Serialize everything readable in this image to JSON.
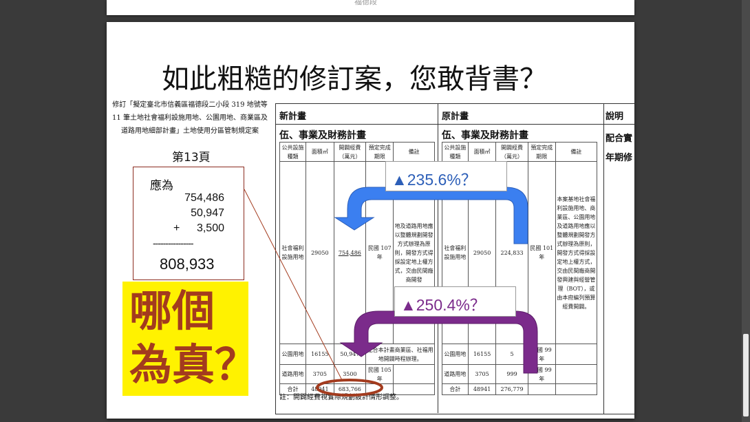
{
  "prev_slide": {
    "text": "福德段"
  },
  "title": "如此粗糙的修訂案，您敢背書？",
  "declaration": "修訂「擬定臺北市信義區福德段二小段 319 地號等 11 筆土地社會福利設施用地、公園用地、商業區及道路用地細部計畫」土地使用分區管制規定案",
  "page_label": "第13頁",
  "calc": {
    "heading": "應為",
    "line1": "754,486",
    "line2": "50,947",
    "plus": "+",
    "line3": "3,500",
    "dashes": "----------------",
    "total": "808,933"
  },
  "question": {
    "line1": "哪個",
    "line2": "為真？"
  },
  "doc": {
    "new_plan": "新計畫",
    "old_plan": "原計畫",
    "explain": "說明",
    "section": "伍、事業及財務計畫",
    "explain_l1": "配合實",
    "explain_l2": "年期修",
    "headers": [
      "公共設施種類",
      "面積㎡",
      "開闢經費（萬元）",
      "預定完成期限",
      "備註"
    ],
    "new_rows": {
      "social": [
        "社會福利設施用地",
        "29050",
        "754,486",
        "民國 107 年"
      ],
      "social_note": "地及道路用地應以整體規劃開發方式辦理為原則，開發方式得採設定地上權方式，交由民間廠商開發",
      "park": [
        "公園用地",
        "16155",
        "50,947"
      ],
      "park_note": "配合本計畫商業區、社福用地開闢時程辦理。",
      "road": [
        "道路用地",
        "3705",
        "3500",
        "民國 105 年"
      ],
      "total": [
        "合計",
        "48941",
        "683,766"
      ]
    },
    "old_rows": {
      "social": [
        "社會福利設施用地",
        "29050",
        "224,833",
        "民國 101 年"
      ],
      "park": [
        "公園用地",
        "16155",
        "5",
        "民國 99 年"
      ],
      "road": [
        "道路用地",
        "3705",
        "999",
        "民國 99 年"
      ],
      "total": [
        "合計",
        "48941",
        "276,779"
      ]
    },
    "old_note": "本案基地社會福利設施用地、商業區、公園用地及道路用地應以整體規劃開發方式辦理為原則，開發方式得採設定地上權方式，交由民間廠商開發興建與經營管理（BOT），或由本府編列預算經費開闢。",
    "footnote": "註：開闢經費視實際規劃設計情形調整。"
  },
  "badges": {
    "b1": "▲235.6%？",
    "b2": "▲250.4%？"
  },
  "colors": {
    "blue_arrow": "#3b7ff0",
    "purple_arrow": "#7b2b8b",
    "red": "#a33b1e",
    "yellow": "#fff200"
  }
}
